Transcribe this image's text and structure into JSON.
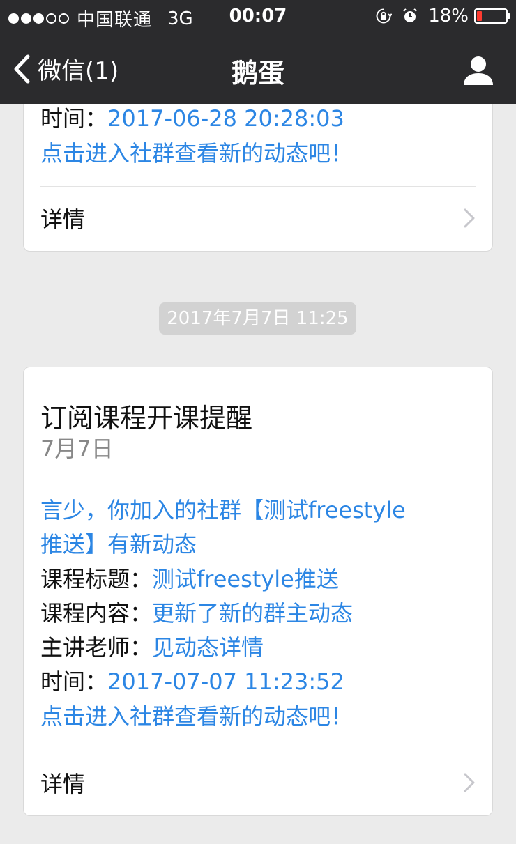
{
  "status_bar": {
    "carrier": "中国联通",
    "network": "3G",
    "time": "00:07",
    "battery_percent": "18%",
    "battery_level": 0.18,
    "signal_bars": 3,
    "signal_total": 5
  },
  "nav": {
    "back_label": "微信(1)",
    "title": "鹅蛋",
    "profile_icon": "person-icon"
  },
  "card_top": {
    "time_label": "时间：",
    "time_value": "2017-06-28 20:28:03",
    "cta": "点击进入社群查看新的动态吧！",
    "detail_label": "详情"
  },
  "timestamp": "2017年7月7日 11:25",
  "card_main": {
    "title": "订阅课程开课提醒",
    "date": "7月7日",
    "intro_line1": "言少，你加入的社群【测试freestyle",
    "intro_line2": "推送】有新动态",
    "course_title_label": "课程标题：",
    "course_title_value": "测试freestyle推送",
    "course_content_label": "课程内容：",
    "course_content_value": "更新了新的群主动态",
    "teacher_label": "主讲老师：",
    "teacher_value": "见动态详情",
    "time_label": "时间：",
    "time_value": "2017-07-07 11:23:52",
    "cta": "点击进入社群查看新的动态吧！",
    "detail_label": "详情"
  },
  "colors": {
    "nav_bg": "#2b2b2d",
    "page_bg": "#ebebeb",
    "link_blue": "#2c86e4",
    "battery_red": "#ff3b30",
    "pill_bg": "#d2d2d2"
  }
}
